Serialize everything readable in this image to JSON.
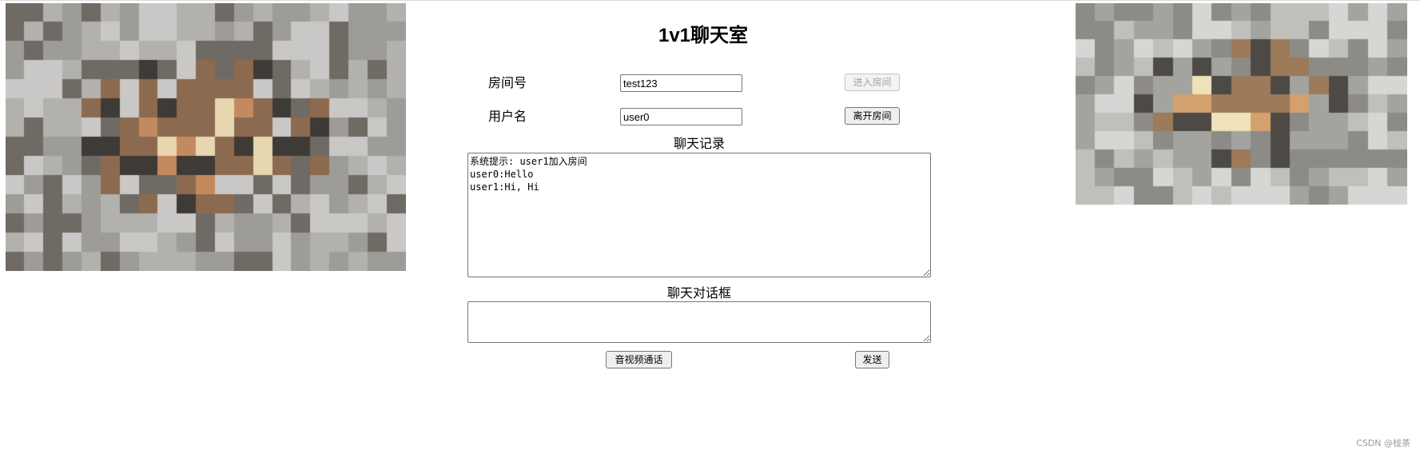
{
  "page": {
    "title": "1v1聊天室"
  },
  "room": {
    "label": "房间号",
    "value": "test123",
    "join_label": "进入房间",
    "join_disabled": true
  },
  "user": {
    "label": "用户名",
    "value": "user0",
    "leave_label": "离开房间"
  },
  "chat_log": {
    "label": "聊天记录",
    "content": "系统提示: user1加入房间\nuser0:Hello\nuser1:Hi, Hi"
  },
  "chat_input": {
    "label": "聊天对话框",
    "value": ""
  },
  "actions": {
    "av_call_label": "音视频通话",
    "send_label": "发送"
  },
  "videos": {
    "local": "local-video (pixelated)",
    "remote": "remote-video (pixelated)"
  },
  "watermark": "CSDN @栊茶"
}
